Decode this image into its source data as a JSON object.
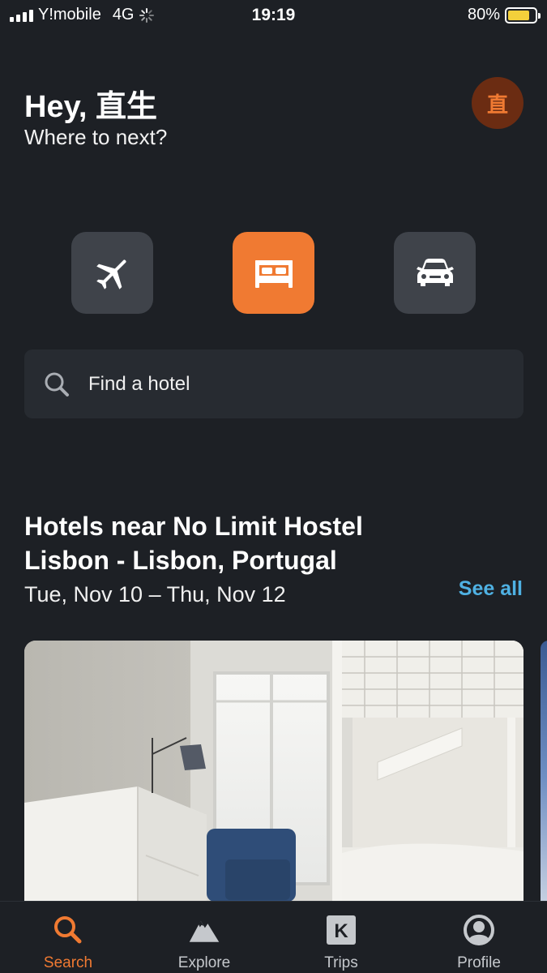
{
  "status_bar": {
    "carrier": "Y!mobile",
    "network": "4G",
    "time": "19:19",
    "battery_percent_label": "80%",
    "battery_level": 0.8
  },
  "header": {
    "greeting": "Hey, 直生",
    "subtitle": "Where to next?",
    "avatar_initial": "直"
  },
  "verticals": [
    {
      "name": "flights",
      "icon": "plane-icon",
      "active": false
    },
    {
      "name": "hotels",
      "icon": "bed-icon",
      "active": true
    },
    {
      "name": "cars",
      "icon": "car-icon",
      "active": false
    }
  ],
  "search": {
    "placeholder": "Find a hotel",
    "icon": "search-icon"
  },
  "section": {
    "title": "Hotels near No Limit Hostel Lisbon - Lisbon, Portugal",
    "dates": "Tue, Nov 10 – Thu, Nov 12",
    "see_all": "See all"
  },
  "tabs": [
    {
      "label": "Search",
      "icon": "search-icon",
      "active": true
    },
    {
      "label": "Explore",
      "icon": "mountain-icon",
      "active": false
    },
    {
      "label": "Trips",
      "icon": "kayak-k-icon",
      "active": false
    },
    {
      "label": "Profile",
      "icon": "profile-icon",
      "active": false
    }
  ],
  "colors": {
    "background": "#1d2025",
    "accent": "#f07a32",
    "link": "#4fb1e3",
    "button": "#3f434a",
    "battery": "#f3d03b",
    "avatar_bg": "#6b2c12"
  }
}
